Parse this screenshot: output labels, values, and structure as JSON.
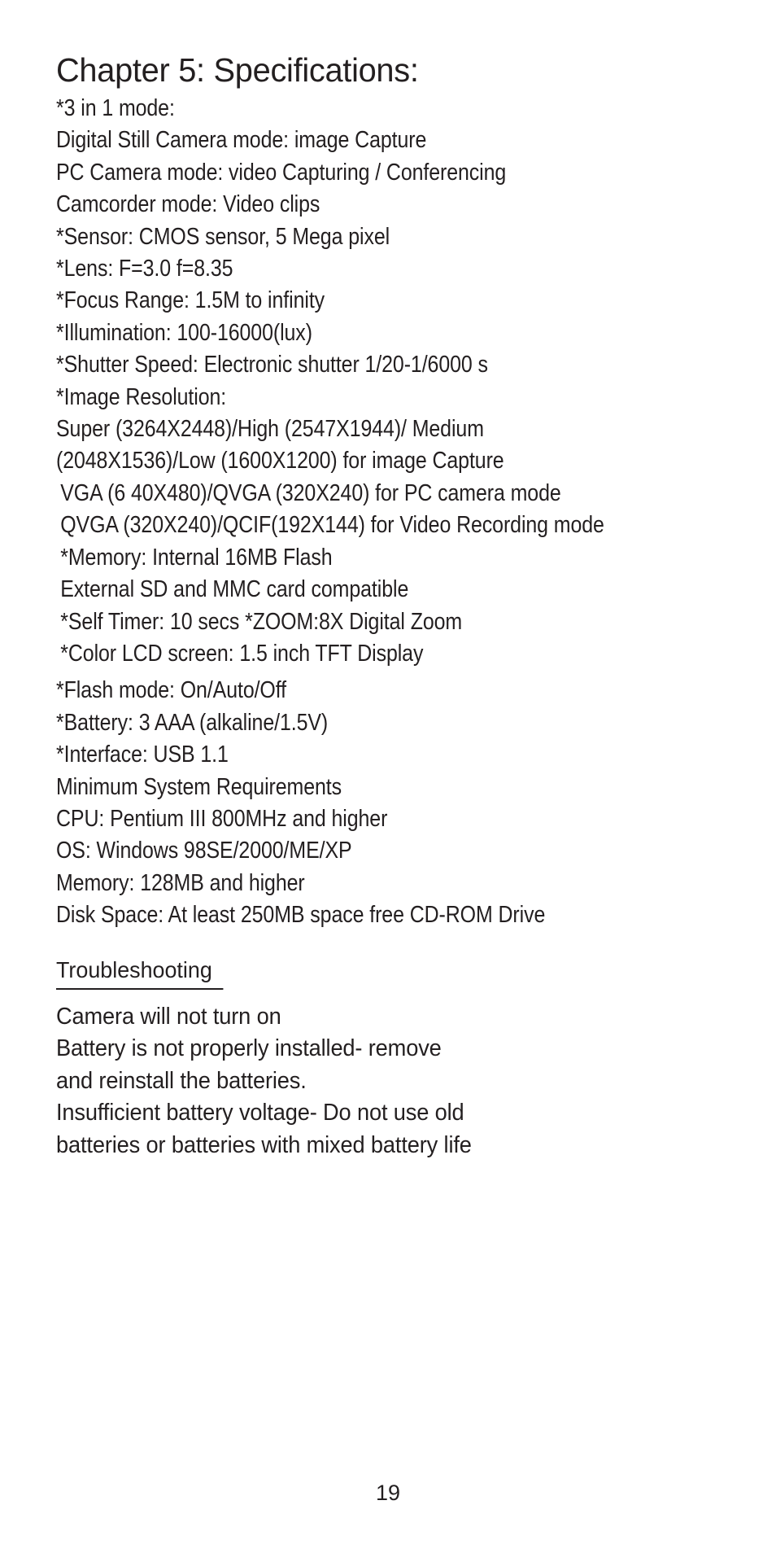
{
  "document": {
    "chapter_title": "Chapter 5: Specifications:",
    "specifications": [
      {
        "text": "*3 in 1 mode:",
        "indent": false,
        "gap_before": false
      },
      {
        "text": "Digital Still Camera mode: image Capture",
        "indent": false,
        "gap_before": false
      },
      {
        "text": "PC Camera mode: video Capturing / Conferencing",
        "indent": false,
        "gap_before": false
      },
      {
        "text": "Camcorder mode: Video clips",
        "indent": false,
        "gap_before": false
      },
      {
        "text": "*Sensor: CMOS sensor, 5 Mega pixel",
        "indent": false,
        "gap_before": false
      },
      {
        "text": "*Lens: F=3.0 f=8.35",
        "indent": false,
        "gap_before": false
      },
      {
        "text": "*Focus Range: 1.5M to infinity",
        "indent": false,
        "gap_before": false
      },
      {
        "text": "*Illumination: 100-16000(lux)",
        "indent": false,
        "gap_before": false
      },
      {
        "text": "*Shutter Speed: Electronic shutter 1/20-1/6000 s",
        "indent": false,
        "gap_before": false
      },
      {
        "text": "*Image Resolution:",
        "indent": false,
        "gap_before": false
      },
      {
        "text": "Super (3264X2448)/High (2547X1944)/ Medium",
        "indent": false,
        "gap_before": false
      },
      {
        "text": "(2048X1536)/Low (1600X1200) for image Capture",
        "indent": false,
        "gap_before": false
      },
      {
        "text": "VGA (6 40X480)/QVGA (320X240) for PC camera mode",
        "indent": true,
        "gap_before": false
      },
      {
        "text": "QVGA (320X240)/QCIF(192X144) for Video Recording mode",
        "indent": true,
        "gap_before": false
      },
      {
        "text": "*Memory: Internal 16MB Flash",
        "indent": true,
        "gap_before": false
      },
      {
        "text": "External SD and MMC card compatible",
        "indent": true,
        "gap_before": false
      },
      {
        "text": "*Self Timer: 10 secs *ZOOM:8X Digital Zoom",
        "indent": true,
        "gap_before": false
      },
      {
        "text": "*Color LCD screen: 1.5 inch TFT Display",
        "indent": true,
        "gap_before": false
      },
      {
        "text": "*Flash mode: On/Auto/Off",
        "indent": false,
        "gap_before": true
      },
      {
        "text": "*Battery: 3 AAA (alkaline/1.5V)",
        "indent": false,
        "gap_before": false
      },
      {
        "text": "*Interface: USB 1.1",
        "indent": false,
        "gap_before": false
      },
      {
        "text": "Minimum System Requirements",
        "indent": false,
        "gap_before": false
      },
      {
        "text": "CPU: Pentium III 800MHz and higher",
        "indent": false,
        "gap_before": false
      },
      {
        "text": "OS: Windows 98SE/2000/ME/XP",
        "indent": false,
        "gap_before": false
      },
      {
        "text": "Memory: 128MB and higher",
        "indent": false,
        "gap_before": false
      },
      {
        "text": "Disk Space: At least 250MB space free CD-ROM Drive",
        "indent": false,
        "gap_before": false
      }
    ],
    "troubleshooting": {
      "heading": "Troubleshooting",
      "lines": [
        "Camera will not turn on",
        "Battery is not properly installed- remove",
        "and reinstall the batteries.",
        "Insufficient battery voltage- Do not use old",
        "batteries or batteries with mixed battery life"
      ]
    },
    "page_number": "19"
  }
}
